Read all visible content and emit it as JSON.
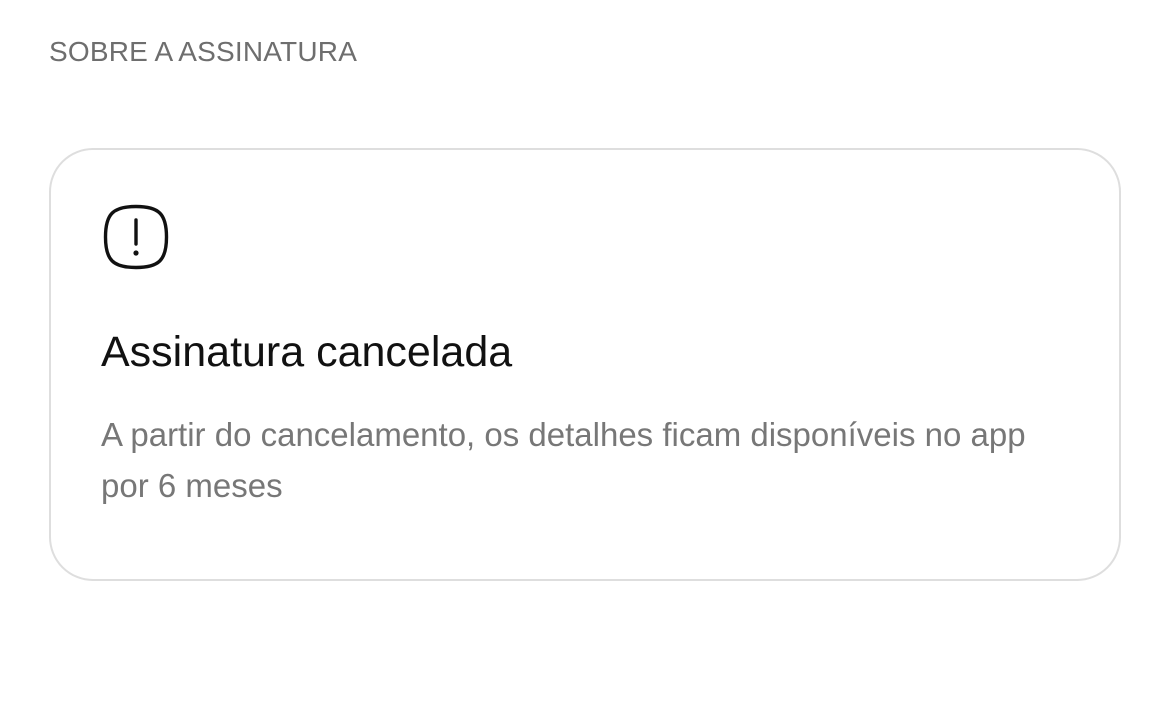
{
  "section": {
    "header": "SOBRE A ASSINATURA"
  },
  "status_card": {
    "icon": "alert-circle-icon",
    "title": "Assinatura cancelada",
    "description": "A partir do cancelamento, os detalhes ficam disponíveis no app por 6 meses"
  },
  "colors": {
    "background": "#ffffff",
    "card_border": "#dedede",
    "title_text": "#111111",
    "secondary_text": "#777777",
    "header_text": "#6e6e6e"
  }
}
